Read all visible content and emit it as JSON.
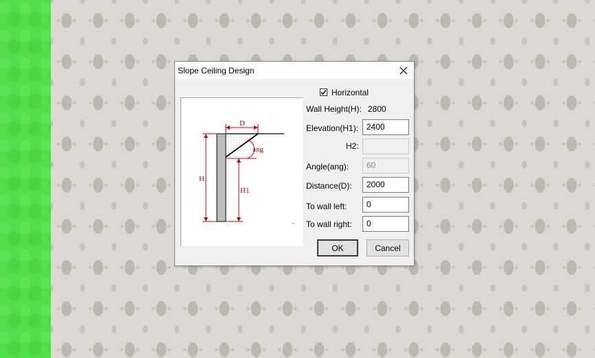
{
  "dialog": {
    "title": "Slope Ceiling Design",
    "close_icon": "close-icon",
    "horizontal_label": "Horizontal",
    "horizontal_checked": true,
    "wall_height_label": "Wall Height(H):",
    "wall_height_value": "2800",
    "elevation_label": "Elevation(H1):",
    "elevation_value": "2400",
    "h2_label": "H2:",
    "h2_value": "",
    "angle_label": "Angle(ang):",
    "angle_value": "60",
    "distance_label": "Distance(D):",
    "distance_value": "2000",
    "wall_left_label": "To wall left:",
    "wall_left_value": "0",
    "wall_right_label": "To wall right:",
    "wall_right_value": "0",
    "ok_label": "OK",
    "cancel_label": "Cancel"
  },
  "diagram": {
    "label_d": "D",
    "label_h": "H",
    "label_h1": "H1",
    "label_ang": "ang",
    "dimension_color": "#cc0000"
  },
  "background": {
    "left_strip_color": "#52e04a",
    "wallpaper_color": "#dcd8d3"
  }
}
